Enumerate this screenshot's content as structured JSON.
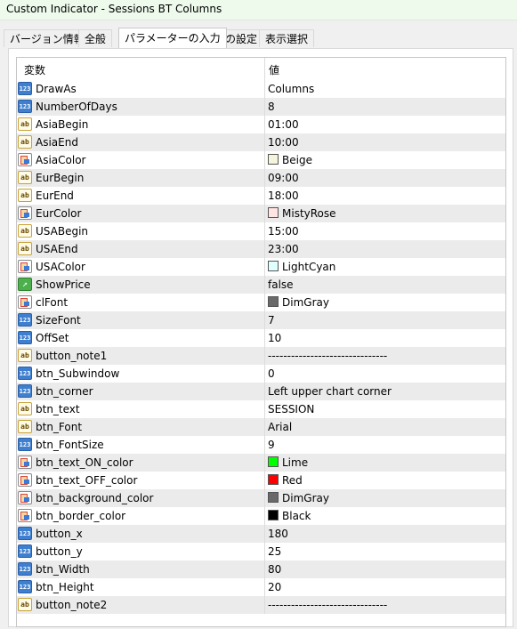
{
  "window": {
    "title": "Custom Indicator - Sessions BT Columns"
  },
  "tabs": [
    {
      "label": "バージョン情報",
      "active": false
    },
    {
      "label": "全般",
      "active": false
    },
    {
      "label": "パラメーターの入力",
      "active": true
    },
    {
      "label": "色の設定",
      "active": false
    },
    {
      "label": "表示選択",
      "active": false
    }
  ],
  "grid": {
    "header": {
      "variable": "変数",
      "value": "値"
    },
    "rows": [
      {
        "icon": "int-icon",
        "name": "DrawAs",
        "value": "Columns"
      },
      {
        "icon": "int-icon",
        "name": "NumberOfDays",
        "value": "8"
      },
      {
        "icon": "string-icon",
        "name": "AsiaBegin",
        "value": "01:00"
      },
      {
        "icon": "string-icon",
        "name": "AsiaEnd",
        "value": "10:00"
      },
      {
        "icon": "color-icon",
        "name": "AsiaColor",
        "value": "Beige",
        "swatch": "#f5f5dc"
      },
      {
        "icon": "string-icon",
        "name": "EurBegin",
        "value": "09:00"
      },
      {
        "icon": "string-icon",
        "name": "EurEnd",
        "value": "18:00"
      },
      {
        "icon": "color-icon",
        "name": "EurColor",
        "value": "MistyRose",
        "swatch": "#ffe4e1"
      },
      {
        "icon": "string-icon",
        "name": "USABegin",
        "value": "15:00"
      },
      {
        "icon": "string-icon",
        "name": "USAEnd",
        "value": "23:00"
      },
      {
        "icon": "color-icon",
        "name": "USAColor",
        "value": "LightCyan",
        "swatch": "#e0ffff"
      },
      {
        "icon": "bool-icon",
        "name": "ShowPrice",
        "value": "false"
      },
      {
        "icon": "color-icon",
        "name": "clFont",
        "value": "DimGray",
        "swatch": "#696969"
      },
      {
        "icon": "int-icon",
        "name": "SizeFont",
        "value": "7"
      },
      {
        "icon": "int-icon",
        "name": "OffSet",
        "value": "10"
      },
      {
        "icon": "string-icon",
        "name": "button_note1",
        "value": "-------------------------------"
      },
      {
        "icon": "int-icon",
        "name": "btn_Subwindow",
        "value": "0"
      },
      {
        "icon": "int-icon",
        "name": "btn_corner",
        "value": "Left upper chart corner"
      },
      {
        "icon": "string-icon",
        "name": "btn_text",
        "value": "SESSION"
      },
      {
        "icon": "string-icon",
        "name": "btn_Font",
        "value": "Arial"
      },
      {
        "icon": "int-icon",
        "name": "btn_FontSize",
        "value": "9"
      },
      {
        "icon": "color-icon",
        "name": "btn_text_ON_color",
        "value": "Lime",
        "swatch": "#00ff00"
      },
      {
        "icon": "color-icon",
        "name": "btn_text_OFF_color",
        "value": "Red",
        "swatch": "#ff0000"
      },
      {
        "icon": "color-icon",
        "name": "btn_background_color",
        "value": "DimGray",
        "swatch": "#696969"
      },
      {
        "icon": "color-icon",
        "name": "btn_border_color",
        "value": "Black",
        "swatch": "#000000"
      },
      {
        "icon": "int-icon",
        "name": "button_x",
        "value": "180"
      },
      {
        "icon": "int-icon",
        "name": "button_y",
        "value": "25"
      },
      {
        "icon": "int-icon",
        "name": "btn_Width",
        "value": "80"
      },
      {
        "icon": "int-icon",
        "name": "btn_Height",
        "value": "20"
      },
      {
        "icon": "string-icon",
        "name": "button_note2",
        "value": "-------------------------------"
      }
    ]
  },
  "icon_text": {
    "int-icon": "123",
    "string-icon": "ab",
    "bool-icon": "↗"
  }
}
